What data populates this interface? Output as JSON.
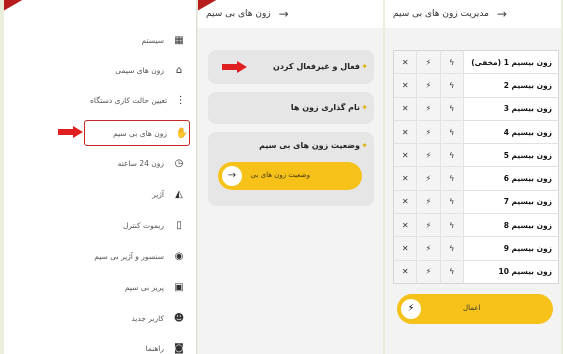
{
  "sidebar": {
    "items": [
      {
        "label": "سیستم",
        "icon": "calendar-icon",
        "glyph": "▦"
      },
      {
        "label": "زون های سیمی",
        "icon": "zone-icon",
        "glyph": "⌂"
      },
      {
        "label": "تعیین حالت کاری دستگاه",
        "icon": "mode-icon",
        "glyph": "⋮"
      },
      {
        "label": "زون های بی سیم",
        "icon": "wireless-zone-icon",
        "glyph": "✋"
      },
      {
        "label": "زون 24 ساعته",
        "icon": "clock-icon",
        "glyph": "◷"
      },
      {
        "label": "آژیر",
        "icon": "siren-icon",
        "glyph": "◭"
      },
      {
        "label": "ریموت کنترل",
        "icon": "remote-icon",
        "glyph": "▯"
      },
      {
        "label": "سنسور و آژیر بی سیم",
        "icon": "signal-icon",
        "glyph": "((•))"
      },
      {
        "label": "پریز بی سیم",
        "icon": "socket-icon",
        "glyph": "▣"
      },
      {
        "label": "کاربر جدید",
        "icon": "users-icon",
        "glyph": "👥"
      },
      {
        "label": "راهنما",
        "icon": "help-icon",
        "glyph": "◙"
      }
    ]
  },
  "middle": {
    "title": "زون های بی سیم",
    "cards": [
      {
        "label": "فعال و غیرفعال کردن"
      },
      {
        "label": "نام گذاری زون ها"
      },
      {
        "label": "وضعیت زون های بی سیم",
        "button": "وضعیت زون های بی"
      }
    ]
  },
  "right": {
    "title": "مدیریت زون های بی سیم",
    "zones": [
      "زون بیسیم 1 (مخفی)",
      "زون بیسیم 2",
      "زون بیسیم 3",
      "زون بیسیم 4",
      "زون بیسیم 5",
      "زون بیسیم 6",
      "زون بیسیم 7",
      "زون بیسیم 8",
      "زون بیسیم 9",
      "زون بیسیم 10"
    ],
    "apply_label": "اعمال"
  }
}
